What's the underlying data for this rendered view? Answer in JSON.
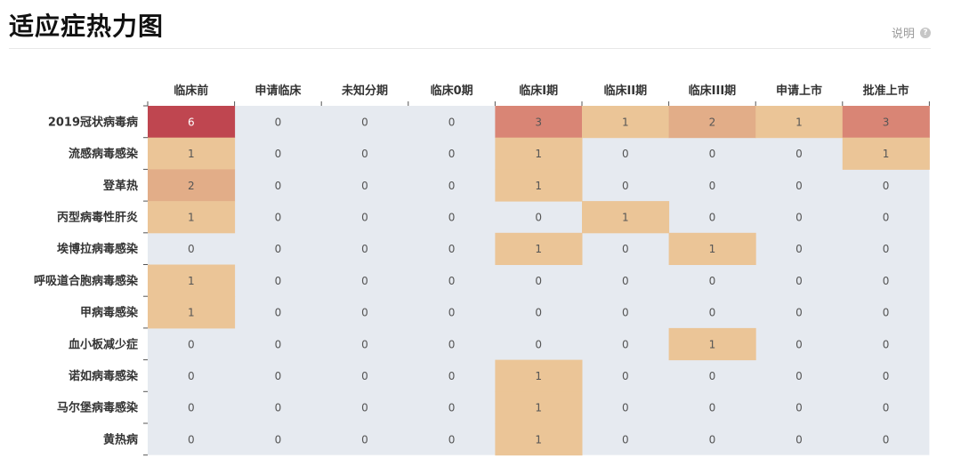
{
  "header": {
    "title": "适应症热力图",
    "help_label": "说明",
    "help_icon": "question-circle-icon"
  },
  "colors": {
    "background": "#e6eaf0",
    "scale": [
      "#e6eaf0",
      "#ebc597",
      "#e2ad88",
      "#d98575",
      "#bf4650"
    ],
    "cell_text_dark": "#555555",
    "cell_text_light": "#ffffff"
  },
  "chart_data": {
    "type": "heatmap",
    "x_categories": [
      "临床前",
      "申请临床",
      "未知分期",
      "临床0期",
      "临床I期",
      "临床II期",
      "临床III期",
      "申请上市",
      "批准上市"
    ],
    "y_categories": [
      "2019冠状病毒病",
      "流感病毒感染",
      "登革热",
      "丙型病毒性肝炎",
      "埃博拉病毒感染",
      "呼吸道合胞病毒感染",
      "甲病毒感染",
      "血小板减少症",
      "诺如病毒感染",
      "马尔堡病毒感染",
      "黄热病"
    ],
    "values": [
      [
        6,
        0,
        0,
        0,
        3,
        1,
        2,
        1,
        3
      ],
      [
        1,
        0,
        0,
        0,
        1,
        0,
        0,
        0,
        1
      ],
      [
        2,
        0,
        0,
        0,
        1,
        0,
        0,
        0,
        0
      ],
      [
        1,
        0,
        0,
        0,
        0,
        1,
        0,
        0,
        0
      ],
      [
        0,
        0,
        0,
        0,
        1,
        0,
        1,
        0,
        0
      ],
      [
        1,
        0,
        0,
        0,
        0,
        0,
        0,
        0,
        0
      ],
      [
        1,
        0,
        0,
        0,
        0,
        0,
        0,
        0,
        0
      ],
      [
        0,
        0,
        0,
        0,
        0,
        0,
        1,
        0,
        0
      ],
      [
        0,
        0,
        0,
        0,
        1,
        0,
        0,
        0,
        0
      ],
      [
        0,
        0,
        0,
        0,
        1,
        0,
        0,
        0,
        0
      ],
      [
        0,
        0,
        0,
        0,
        1,
        0,
        0,
        0,
        0
      ]
    ],
    "min": 0,
    "max": 6
  }
}
